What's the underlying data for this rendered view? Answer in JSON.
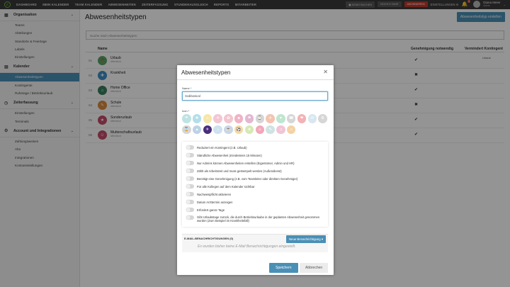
{
  "topbar": {
    "nav": [
      "DASHBOARD",
      "MEIN KALENDER",
      "TEAM KALENDER",
      "ABWESENHEITEN",
      "ZEITERFASSUNG",
      "STUNDENAUSGLEICH",
      "REPORTS",
      "MITARBEITER"
    ],
    "demo_label": "DEMO BUCHEN",
    "trial_label": "NOCH 6 TAGE",
    "upgrade_label": "ABONNIEREN",
    "settings_label": "EINSTELLUNGEN",
    "notif_count": "1",
    "user_name": "Diana Meier",
    "user_role": "Admin"
  },
  "sidebar": {
    "sections": [
      {
        "title": "Organisation",
        "icon": "grid-icon",
        "items": [
          "Teams",
          "Abteilungen",
          "Standorte & Feiertage",
          "Labels",
          "Einstellungen"
        ]
      },
      {
        "title": "Kalender",
        "icon": "calendar-icon",
        "items": [
          "Abwesenheitstypen",
          "Kontingente",
          "Ruhetage / Betriebsurlaub"
        ],
        "active": "Abwesenheitstypen"
      },
      {
        "title": "Zeiterfassung",
        "icon": "clock-icon",
        "items": [
          "Einstellungen",
          "Terminals"
        ]
      },
      {
        "title": "Account und Integrationen",
        "icon": "gear-icon",
        "items": [
          "Zahlungsweisen",
          "Abo",
          "Integrationen",
          "Kontoeinstellungen"
        ]
      }
    ]
  },
  "main": {
    "title": "Abwesenheitstypen",
    "create_label": "Abwesenheitstyp erstellen",
    "search_placeholder": "Suche nach Abwesenheitstypen",
    "columns": {
      "name": "Name",
      "approval": "Genehmigung notwendig",
      "reduce": "Vermindert Kontingent"
    },
    "rows": [
      {
        "num": "01",
        "name": "Urlaub",
        "sub": "öffentlich",
        "color": "#5aa36b",
        "icon": "palm-icon",
        "approval": "check",
        "reduce": "Urlaub"
      },
      {
        "num": "02",
        "name": "Krankheit",
        "sub": "",
        "color": "#3d8fc6",
        "icon": "medical-icon",
        "approval": "x",
        "reduce": ""
      },
      {
        "num": "03",
        "name": "Home Office",
        "sub": "öffentlich",
        "color": "#3a7e60",
        "icon": "home-icon",
        "approval": "check",
        "reduce": ""
      },
      {
        "num": "04",
        "name": "Schule",
        "sub": "öffentlich",
        "color": "#d98a3d",
        "icon": "school-icon",
        "approval": "x",
        "reduce": ""
      },
      {
        "num": "05",
        "name": "Sonderurlaub",
        "sub": "öffentlich",
        "color": "#c44b6c",
        "icon": "star-icon",
        "approval": "check",
        "reduce": ""
      },
      {
        "num": "06",
        "name": "Mutterschaftsurlaub",
        "sub": "öffentlich",
        "color": "#c44b6c",
        "icon": "baby-icon",
        "approval": "check",
        "reduce": ""
      }
    ]
  },
  "modal": {
    "title": "Abwesenheitstypen",
    "name_label": "Name *",
    "name_value": "Sabbatical",
    "icon_label": "Icon *",
    "icon_row1": [
      {
        "c": "#bfe3e3",
        "g": "☂"
      },
      {
        "c": "#b3dfe9",
        "g": "✚"
      },
      {
        "c": "#f6e6a8",
        "g": "⌂"
      },
      {
        "c": "#f3c6d3",
        "g": "☀"
      },
      {
        "c": "#f3c6cf",
        "g": "✿"
      },
      {
        "c": "#f0b3c6",
        "g": "♣"
      },
      {
        "c": "#e3b8d2",
        "g": "⚑"
      },
      {
        "c": "#d6d6d6",
        "g": "⌚"
      },
      {
        "c": "#f4c4b0",
        "g": "✈"
      },
      {
        "c": "#bfe6d0",
        "g": "♥"
      },
      {
        "c": "#d6d6d6",
        "g": "☎"
      },
      {
        "c": "#f3b2b5",
        "g": "❤"
      },
      {
        "c": "#d8e7ef",
        "g": "✉"
      },
      {
        "c": "#d6d6d6",
        "g": "⚙"
      }
    ],
    "icon_row2": [
      {
        "c": "#d6d6d6",
        "g": "⌛"
      },
      {
        "c": "#bcd2e6",
        "g": "▲"
      },
      {
        "c": "#4a2e7a",
        "g": "✈"
      },
      {
        "c": "#cde1ee",
        "g": "♪"
      },
      {
        "c": "#c9d6e6",
        "g": "☕"
      },
      {
        "c": "#f6d8a0",
        "g": "⚽"
      },
      {
        "c": "#d7e8b4",
        "g": "★"
      },
      {
        "c": "#f2a7b8",
        "g": "☺"
      },
      {
        "c": "#cfe3e3",
        "g": "✎"
      },
      {
        "c": "#f0c5d7",
        "g": "♫"
      },
      {
        "c": "#f4d2a4",
        "g": "☼"
      }
    ],
    "options": [
      "Reduziert ein Kontingent (z.B. Urlaub)",
      "Ständliche Abwesenheit (mindestens 15 Minuten)",
      "Nur Admins können Abwesenheiten erstellen (Eigentümer, Admin und HR)",
      "Zählt als Arbeitszeit und muss gestempelt werden (Außendienst)",
      "Benötigt eine Genehmigung (z.B. vom Teamleiter oder direkten Genehmiger)",
      "Für alle Kollegen auf dem Kalender sichtbar",
      "Nachweispflicht aktivieren",
      "Datum Arzttermin anzeigen",
      "Erfordert ganze Tage",
      "Gibt Urlaubstage zurück, die durch Betriebsurlaube in der geplanten Abwesenheit genommen wurden (Zum Beispiel im Krankheitsfall)"
    ],
    "notif_title": "E-MAIL-BENACHRICHTIGUNGEN (0)",
    "notif_button": "Neue Benachrichtigung",
    "notif_empty": "Es wurden bisher keine E-Mail Benachrichtigungen eingestellt.",
    "save_label": "Speichern",
    "cancel_label": "Abbrechen"
  }
}
